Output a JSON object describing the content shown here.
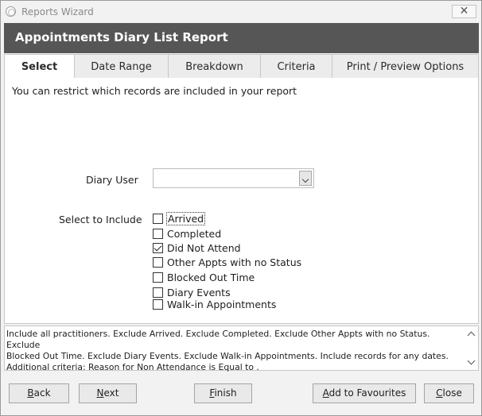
{
  "window": {
    "title": "Reports Wizard",
    "close_glyph": "✕"
  },
  "header": {
    "title": "Appointments Diary List Report"
  },
  "tabs": [
    {
      "label": "Select",
      "active": true
    },
    {
      "label": "Date Range",
      "active": false
    },
    {
      "label": "Breakdown",
      "active": false
    },
    {
      "label": "Criteria",
      "active": false
    },
    {
      "label": "Print / Preview Options",
      "active": false
    }
  ],
  "select_tab": {
    "intro": "You can restrict which records are included in your report",
    "diary_user": {
      "label": "Diary User",
      "value": ""
    },
    "include": {
      "label": "Select to Include",
      "options": [
        {
          "label": "Arrived",
          "checked": false
        },
        {
          "label": "Completed",
          "checked": false
        },
        {
          "label": "Did Not Attend",
          "checked": true
        },
        {
          "label": "Other Appts with no Status",
          "checked": false
        },
        {
          "label": "Blocked Out Time",
          "checked": false
        },
        {
          "label": "Diary Events",
          "checked": false
        },
        {
          "label": "Walk-in Appointments",
          "checked": false
        }
      ]
    }
  },
  "summary": {
    "line1": "Include all practitioners. Exclude Arrived. Exclude Completed. Exclude Other Appts with no Status. Exclude",
    "line2": "Blocked Out Time. Exclude Diary Events. Exclude Walk-in Appointments. Include records for any dates.",
    "line3": "Additional criteria: Reason for Non Attendance is Equal to ."
  },
  "buttons": {
    "back": {
      "first": "B",
      "rest": "ack"
    },
    "next": {
      "first": "N",
      "rest": "ext"
    },
    "finish": {
      "first": "F",
      "rest": "inish"
    },
    "favourites": {
      "first": "A",
      "rest": "dd to Favourites"
    },
    "close": {
      "first": "C",
      "rest": "lose"
    }
  },
  "icons": {
    "app": "app-circle-icon",
    "close": "close-icon",
    "dropdown": "chevron-down-icon",
    "scroll_up": "scroll-up-icon",
    "scroll_down": "scroll-down-icon"
  }
}
